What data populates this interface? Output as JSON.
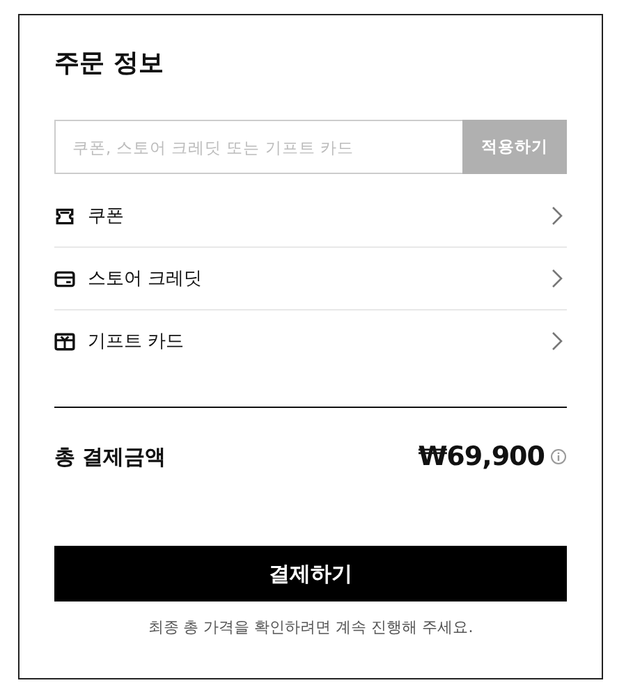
{
  "title": "주문 정보",
  "promo": {
    "placeholder": "쿠폰, 스토어 크레딧 또는 기프트 카드",
    "button": "적용하기"
  },
  "options": [
    {
      "kind": "coupon",
      "label": "쿠폰"
    },
    {
      "kind": "credit",
      "label": "스토어 크레딧"
    },
    {
      "kind": "gift",
      "label": "기프트 카드"
    }
  ],
  "total": {
    "label": "총 결제금액",
    "amount": "₩69,900"
  },
  "pay_button": "결제하기",
  "note": "최종 총 가격을 확인하려면 계속 진행해 주세요."
}
